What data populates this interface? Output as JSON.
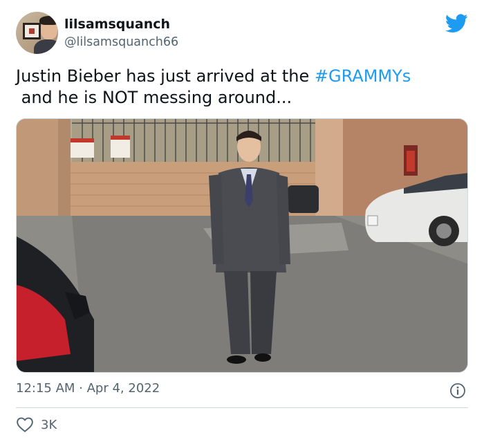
{
  "author": {
    "display_name": "lilsamsquanch",
    "handle": "@lilsamsquanch66"
  },
  "tweet": {
    "text_line1_prefix": "Justin Bieber has just arrived at the ",
    "hashtag": "#GRAMMYs",
    "text_line2": " and he is NOT messing around...",
    "timestamp": "12:15 AM · Apr 4, 2022",
    "like_count": "3K"
  },
  "icons": {
    "brand": "twitter-bird-icon",
    "info": "info-icon",
    "like": "heart-icon"
  },
  "colors": {
    "accent": "#1d9bf0",
    "secondary_text": "#536471",
    "primary_text": "#0f1419",
    "divider": "#cfd9de"
  }
}
